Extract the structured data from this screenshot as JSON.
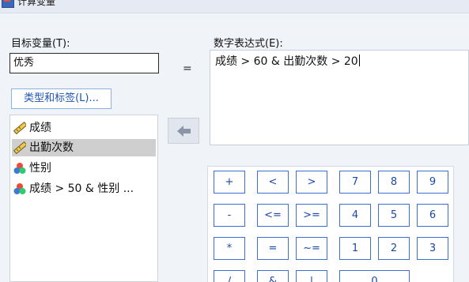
{
  "window": {
    "title": "计算变量"
  },
  "target": {
    "label": "目标变量(T):",
    "value": "优秀",
    "type_label_button": "类型和标签(L)..."
  },
  "equals_sign": "=",
  "expression": {
    "label": "数字表达式(E):",
    "value": "成绩 > 60 & 出勤次数 > 20"
  },
  "variables": [
    {
      "name": "成绩",
      "icon": "ruler-icon",
      "selected": false
    },
    {
      "name": "出勤次数",
      "icon": "ruler-icon",
      "selected": true
    },
    {
      "name": "性别",
      "icon": "nominal-icon",
      "selected": false
    },
    {
      "name": "成绩 > 50 & 性别 ...",
      "icon": "nominal-icon",
      "selected": false
    }
  ],
  "move_button": {
    "icon": "arrow-left-icon"
  },
  "keypad": {
    "row1": [
      "+",
      "<",
      ">",
      "7",
      "8",
      "9"
    ],
    "row2": [
      "-",
      "<=",
      ">=",
      "4",
      "5",
      "6"
    ],
    "row3": [
      "*",
      "=",
      "~=",
      "1",
      "2",
      "3"
    ],
    "row4": [
      "/",
      "&",
      "|",
      "0"
    ]
  },
  "colors": {
    "accent": "#3b6fd4",
    "link_text": "#1d55b5",
    "selection": "#cfcfcf"
  }
}
